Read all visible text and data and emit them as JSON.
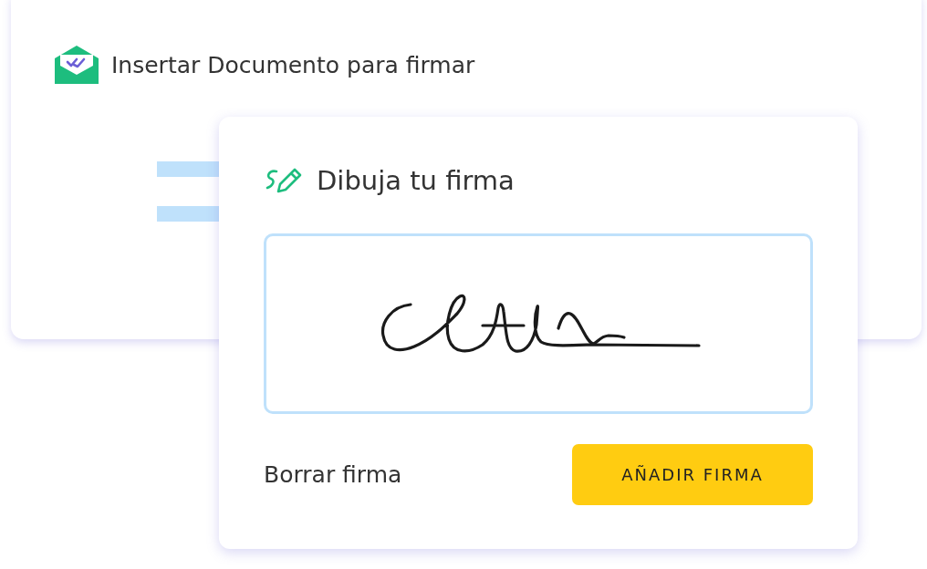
{
  "document_card": {
    "title": "Insertar Documento para firmar"
  },
  "signature_card": {
    "title": "Dibuja tu firma",
    "clear_link": "Borrar firma",
    "add_button": "AÑADIR FIRMA"
  }
}
